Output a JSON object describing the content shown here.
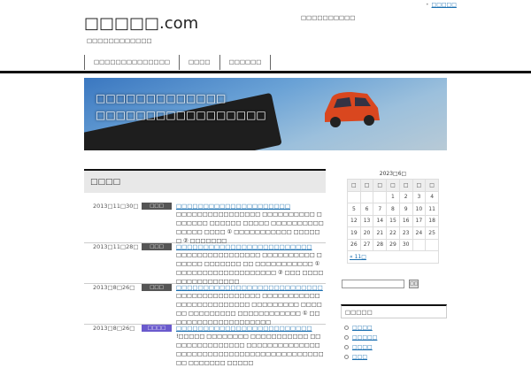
{
  "header": {
    "top_link": "□□□□□",
    "title": "□□□□□.com",
    "tagline": "□□□□□□□□□□□□",
    "center_text": "□□□□□□□□□□"
  },
  "nav": [
    "□□□□□□□□□□□□□□",
    "□□□□",
    "□□□□□□"
  ],
  "hero": {
    "line1": "□□□□□□□□□□□□□",
    "line2": "□□□□□□□□□□□□□□□□□"
  },
  "main": {
    "heading": "□□□□",
    "posts": [
      {
        "date": "2013□11□30□",
        "badge": "□□□",
        "title": "□□□□□□□□□□□□□□□□□□□□□",
        "excerpt": "□□□□□□□□□□□□□□□□ □□□□□□□□□□ □□□□□□□ □□□□□□ □□□□□ □□□□□□□□□□□□□□□ □□□□ ① □□□□□□□□□□□ □□□□□□ ② □□□□□□□"
      },
      {
        "date": "2013□11□28□",
        "badge": "□□□",
        "title": "□□□□□□□□□□□□□□□□□□□□□□□□□",
        "excerpt": "□□□□□□□□□□□□□□□□ □□□□□□□□□□ □□□□□□ □□□□□□□ □□ □□□□□□□□□□□ ① □□□□□□□□□□□□□□□□□□□ ② □□□ □□□□□□□□□□□□□□□□"
      },
      {
        "date": "2013□8□26□",
        "badge": "□□□",
        "title": "□□□□□□□□□□□□□□□□□□□□□□□□□□□",
        "excerpt": "□□□□□□□□□□□□□□□□ □□□□□□□□□□□□□□□□□□□□□□□□□ □□□□□□□□□ □□□□□□ □□□□□□□□□ □□□□□□□□□□□□ ① □□ □□□□□□□□□□□□□□□□□□"
      },
      {
        "date": "2013□8□26□",
        "badge": "□□□□",
        "badge_color": "#6a5acd",
        "title": "□□□□□□□□□□□□□□□□□□□□□□□□□",
        "excerpt": "!□□□□□ □□□□□□□□ □□□□□□□□□□□ □□□□□□□□□□□□□□□ □□□□□□□□□□□□□□□□□□□□□□□□□□□□□□□□□□□□□□□□□□ □□ □□□□□□□ □□□□□"
      }
    ]
  },
  "calendar": {
    "caption": "2023□6□",
    "weekdays": [
      "□",
      "□",
      "□",
      "□",
      "□",
      "□",
      "□"
    ],
    "weeks": [
      [
        "",
        "",
        "",
        "1",
        "2",
        "3",
        "4"
      ],
      [
        "5",
        "6",
        "7",
        "8",
        "9",
        "10",
        "11"
      ],
      [
        "12",
        "13",
        "14",
        "15",
        "16",
        "17",
        "18"
      ],
      [
        "19",
        "20",
        "21",
        "22",
        "23",
        "24",
        "25"
      ],
      [
        "26",
        "27",
        "28",
        "29",
        "30",
        "",
        ""
      ]
    ],
    "prev": "« 11□"
  },
  "search": {
    "value": "",
    "button": "□□"
  },
  "widget": {
    "title": "□□□□□",
    "items": [
      "□□□□",
      "□□□□□",
      "□□□□",
      "□□□"
    ]
  }
}
